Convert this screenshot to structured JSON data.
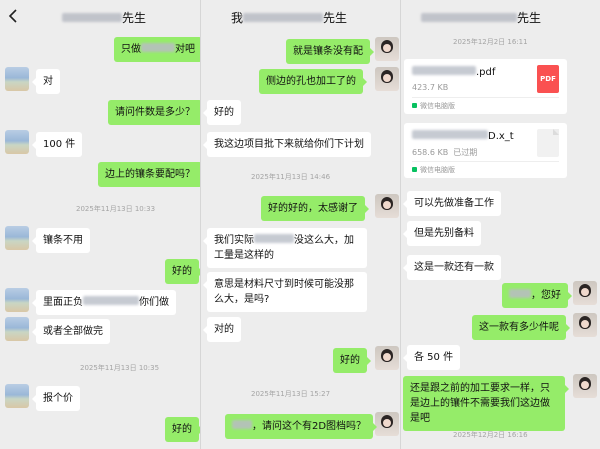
{
  "pane_a": {
    "header": {
      "title_suffix": "先生"
    },
    "messages": [
      {
        "prefix": "只做",
        "suffix": "对吧"
      },
      {
        "text": "对"
      },
      {
        "text": "请问件数是多少？"
      },
      {
        "text": "100 件"
      },
      {
        "text": "边上的镶条要配吗？"
      },
      {
        "text": "镶条不用"
      },
      {
        "text": "好的"
      },
      {
        "prefix": "里面正负",
        "suffix": "你们做"
      },
      {
        "text": "或者全部做完"
      },
      {
        "text": "报个价"
      },
      {
        "text": "好的"
      }
    ],
    "timestamps": [
      "2025年11月13日 10:33",
      "2025年11月13日 10:35"
    ]
  },
  "pane_b": {
    "header": {
      "title_prefix": "我",
      "title_suffix": "先生"
    },
    "messages": [
      {
        "text": "就是镶条没有配"
      },
      {
        "text": "侧边的孔也加工了的"
      },
      {
        "text": "好的"
      },
      {
        "text": "我这边项目批下来就给你们下计划"
      },
      {
        "text": "好的好的，太感谢了"
      },
      {
        "prefix": "我们实际",
        "suffix": "没这么大，加工量是这样的"
      },
      {
        "text": "意思是材料尺寸到时候可能没那么大，是吗?"
      },
      {
        "text": "对的"
      },
      {
        "text": "好的"
      },
      {
        "suffix": "，请问这个有2D图档吗？"
      }
    ],
    "timestamps": [
      "2025年11月13日 14:46",
      "2025年11月13日 15:27"
    ]
  },
  "pane_c": {
    "header": {
      "title_suffix": "先生"
    },
    "timestamps": [
      "2025年12月2日 16:11",
      "2025年12月2日 16:16"
    ],
    "files": [
      {
        "name_suffix": ".pdf",
        "size": "423.7 KB",
        "status": "",
        "source": "微信电脑版",
        "type_label": "PDF"
      },
      {
        "name_suffix": "D.x_t",
        "size": "658.6 KB",
        "status": "已过期",
        "source": "微信电脑版",
        "type_label": ""
      }
    ],
    "messages": [
      {
        "text": "可以先做准备工作"
      },
      {
        "text": "但是先别备料"
      },
      {
        "text": "这是一款还有一款"
      },
      {
        "suffix": "，您好"
      },
      {
        "text": "这一款有多少件呢"
      },
      {
        "text": "各 50 件"
      },
      {
        "text": "还是跟之前的加工要求一样，只是边上的镶件不需要我们这边做是吧"
      }
    ]
  },
  "colors": {
    "background": "#ededed",
    "bubble_in": "#ffffff",
    "bubble_out": "#95ec69",
    "pdf_red": "#fa5151",
    "source_green": "#07c160"
  },
  "icons": [
    "back-chevron-icon",
    "pdf-file-icon",
    "generic-file-icon"
  ]
}
